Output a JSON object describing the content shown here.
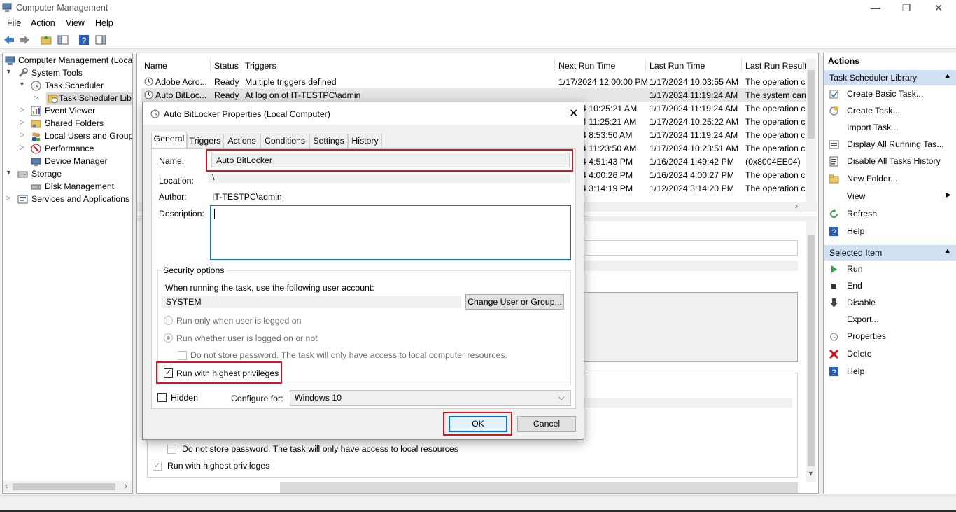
{
  "window": {
    "title": "Computer Management",
    "controls": {
      "minimize": "—",
      "maximize": "❐",
      "close": "✕"
    }
  },
  "menu": [
    "File",
    "Action",
    "View",
    "Help"
  ],
  "tree": {
    "root": "Computer Management (Local",
    "system_tools": "System Tools",
    "task_scheduler": "Task Scheduler",
    "task_scheduler_library": "Task Scheduler Libra",
    "event_viewer": "Event Viewer",
    "shared_folders": "Shared Folders",
    "local_users": "Local Users and Groups",
    "performance": "Performance",
    "device_manager": "Device Manager",
    "storage": "Storage",
    "disk_management": "Disk Management",
    "services": "Services and Applications"
  },
  "task_list": {
    "columns": [
      "Name",
      "Status",
      "Triggers",
      "Next Run Time",
      "Last Run Time",
      "Last Run Result"
    ],
    "rows": [
      {
        "name": "Adobe Acro...",
        "status": "Ready",
        "triggers": "Multiple triggers defined",
        "next": "1/17/2024 12:00:00 PM",
        "last": "1/17/2024 10:03:55 AM",
        "result": "The operation co"
      },
      {
        "name": "Auto BitLoc...",
        "status": "Ready",
        "triggers": "At log on of IT-TESTPC\\admin",
        "next": "",
        "last": "1/17/2024 11:19:24 AM",
        "result": "The system cann"
      },
      {
        "name": "",
        "status": "",
        "triggers": "",
        "next": "4 10:25:21 AM",
        "last": "1/17/2024 11:19:24 AM",
        "result": "The operation co"
      },
      {
        "name": "",
        "status": "",
        "triggers": "",
        "next": "4 11:25:21 AM",
        "last": "1/17/2024 10:25:22 AM",
        "result": "The operation co"
      },
      {
        "name": "",
        "status": "",
        "triggers": "",
        "next": "4 8:53:50 AM",
        "last": "1/17/2024 11:19:24 AM",
        "result": "The operation co"
      },
      {
        "name": "",
        "status": "",
        "triggers": "",
        "next": "4 11:23:50 AM",
        "last": "1/17/2024 10:23:51 AM",
        "result": "The operation co"
      },
      {
        "name": "",
        "status": "",
        "triggers": "",
        "next": "4 4:51:43 PM",
        "last": "1/16/2024 1:49:42 PM",
        "result": "(0x8004EE04)"
      },
      {
        "name": "",
        "status": "",
        "triggers": "",
        "next": "4 4:00:26 PM",
        "last": "1/16/2024 4:00:27 PM",
        "result": "The operation co"
      },
      {
        "name": "",
        "status": "",
        "triggers": "",
        "next": "4 3:14:19 PM",
        "last": "1/12/2024 3:14:20 PM",
        "result": "The operation co"
      }
    ]
  },
  "behind": {
    "no_store": "Do not store password.  The task will only have access to local resources",
    "highest": "Run with highest privileges"
  },
  "actions_pane": {
    "title": "Actions",
    "section1": "Task Scheduler Library",
    "items1": [
      "Create Basic Task...",
      "Create Task...",
      "Import Task...",
      "Display All Running Tas...",
      "Disable All Tasks History",
      "New Folder...",
      "View",
      "Refresh",
      "Help"
    ],
    "section2": "Selected Item",
    "items2": [
      "Run",
      "End",
      "Disable",
      "Export...",
      "Properties",
      "Delete",
      "Help"
    ]
  },
  "dialog": {
    "title": "Auto BitLocker Properties (Local Computer)",
    "tabs": [
      "General",
      "Triggers",
      "Actions",
      "Conditions",
      "Settings",
      "History"
    ],
    "name_label": "Name:",
    "name_value": "Auto BitLocker",
    "location_label": "Location:",
    "location_value": "\\",
    "author_label": "Author:",
    "author_value": "IT-TESTPC\\admin",
    "description_label": "Description:",
    "description_value": "",
    "security_legend": "Security options",
    "account_prompt": "When running the task, use the following user account:",
    "account_value": "SYSTEM",
    "change_user": "Change User or Group...",
    "run_logged_on": "Run only when user is logged on",
    "run_whether": "Run whether user is logged on or not",
    "no_store_password": "Do not store password.  The task will only have access to local computer resources.",
    "highest_privileges": "Run with highest privileges",
    "hidden": "Hidden",
    "configure_label": "Configure for:",
    "configure_value": "Windows 10",
    "ok": "OK",
    "cancel": "Cancel",
    "highest_checked": true,
    "hidden_checked": false
  },
  "colors": {
    "highlight_box": "#d0161e",
    "accent": "#0078d7",
    "section_header": "#cfe0f2"
  }
}
